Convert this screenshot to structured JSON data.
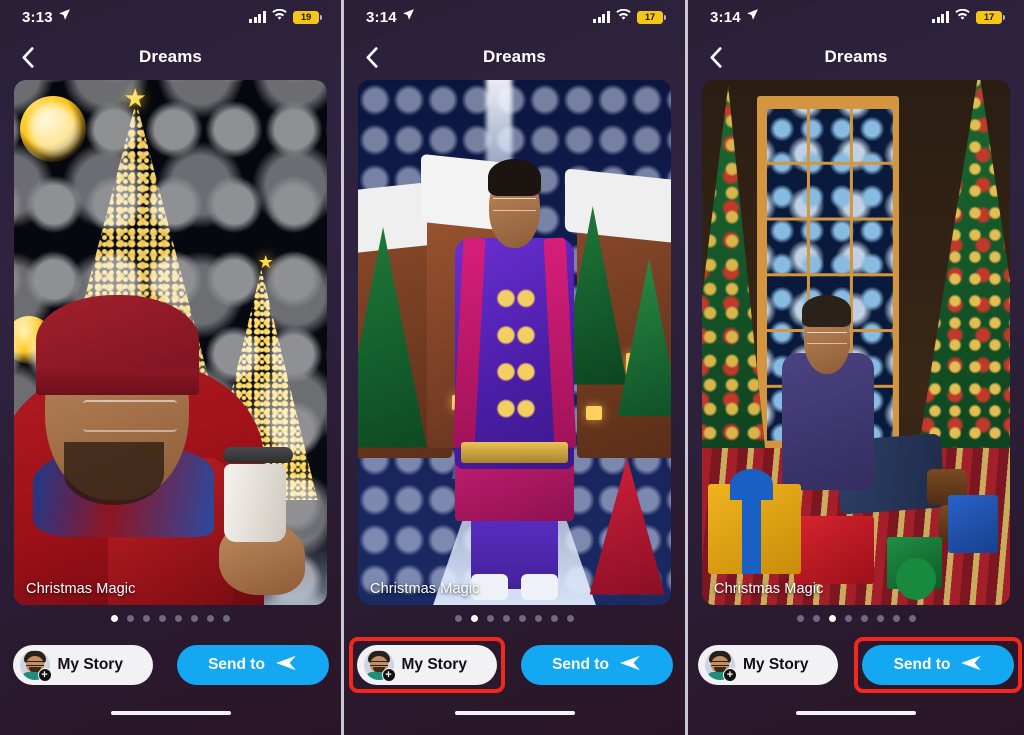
{
  "app": {
    "nav_title": "Dreams",
    "back_icon": "chevron-left-icon",
    "caption": "Christmas Magic",
    "accent_blue": "#14a7f2",
    "highlight_red": "#f5271c",
    "story_button_bg": "#f2f2f4"
  },
  "buttons": {
    "my_story": "My Story",
    "send_to": "Send to",
    "send_icon": "paper-plane-icon",
    "avatar_icon": "bitmoji-avatar-icon",
    "add_badge": "+"
  },
  "panels": [
    {
      "id": "panel-1",
      "status": {
        "time": "3:13",
        "location_icon": "location-arrow-icon",
        "cellular_icon": "cellular-bars-icon",
        "wifi_icon": "wifi-icon",
        "battery_icon": "battery-icon",
        "battery_level": "19",
        "battery_percent": 19
      },
      "caption": "Christmas Magic",
      "dots_total": 8,
      "dot_active": 1,
      "highlight": "none",
      "art": "man-in-red-beanie-with-coffee-by-lit-christmas-trees"
    },
    {
      "id": "panel-2",
      "status": {
        "time": "3:14",
        "location_icon": "location-arrow-icon",
        "cellular_icon": "cellular-bars-icon",
        "wifi_icon": "wifi-icon",
        "battery_icon": "battery-icon",
        "battery_level": "17",
        "battery_percent": 17
      },
      "caption": "Christmas Magic",
      "dots_total": 8,
      "dot_active": 2,
      "highlight": "my-story-button",
      "art": "man-in-purple-nutcracker-coat-in-gingerbread-village"
    },
    {
      "id": "panel-3",
      "status": {
        "time": "3:14",
        "location_icon": "location-arrow-icon",
        "cellular_icon": "cellular-bars-icon",
        "wifi_icon": "wifi-icon",
        "battery_icon": "battery-icon",
        "battery_level": "17",
        "battery_percent": 17
      },
      "caption": "Christmas Magic",
      "dots_total": 8,
      "dot_active": 3,
      "highlight": "send-to-button",
      "art": "man-sitting-among-gifts-by-christmas-trees-indoors"
    }
  ]
}
